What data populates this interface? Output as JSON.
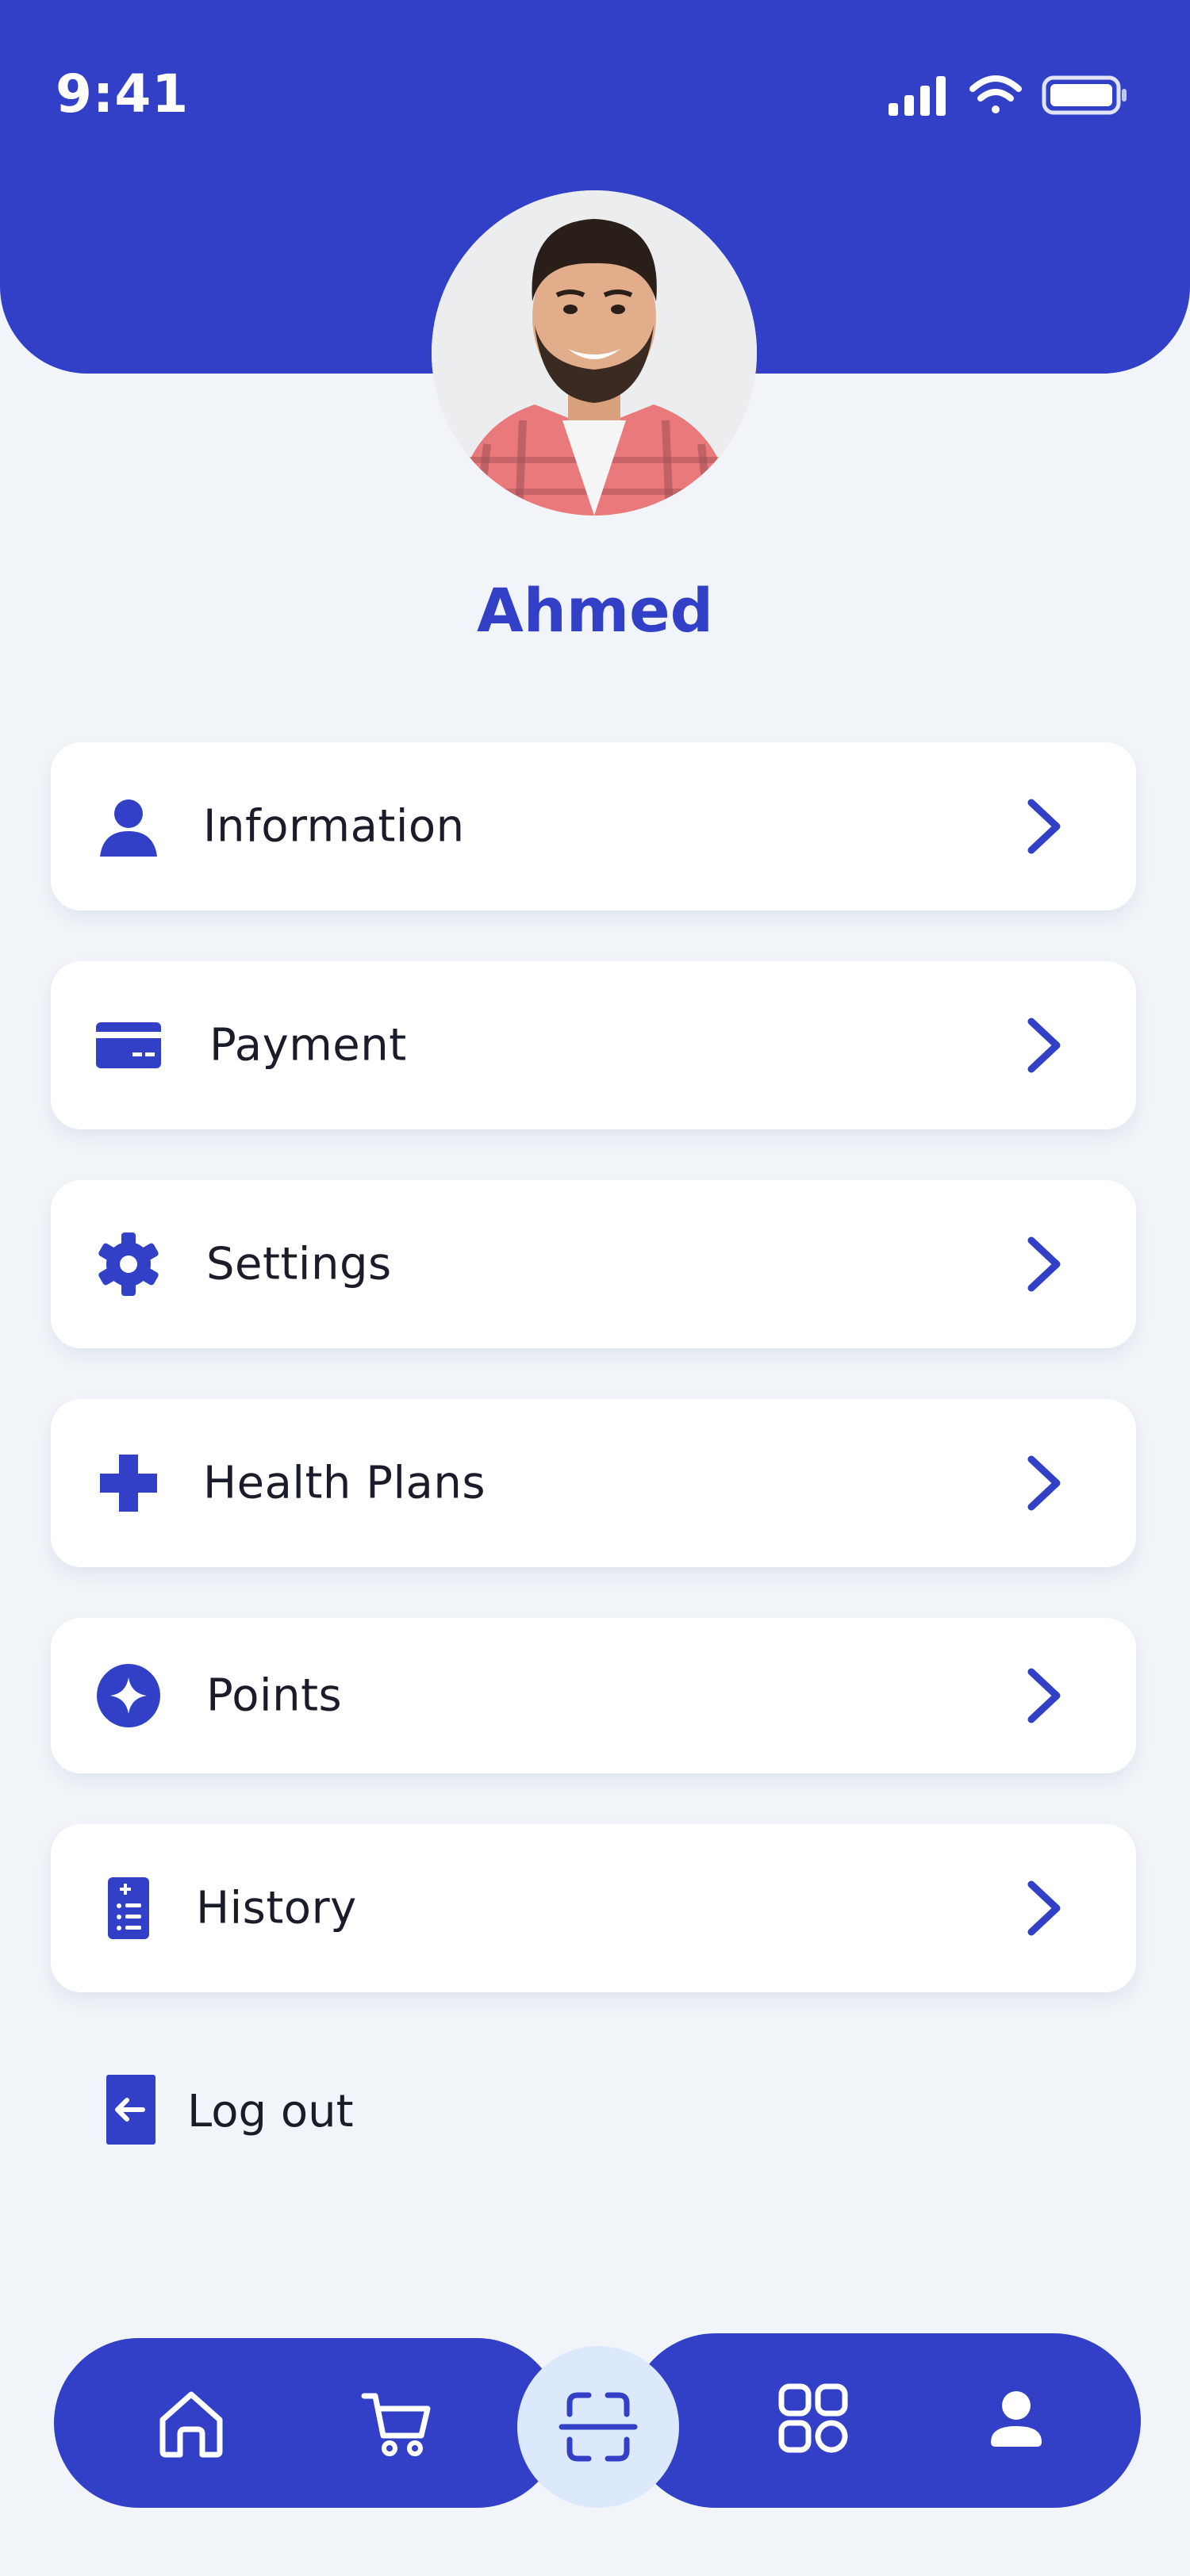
{
  "status_bar": {
    "time": "9:41",
    "icons": [
      "signal-icon",
      "wifi-icon",
      "battery-icon"
    ]
  },
  "profile": {
    "name": "Ahmed"
  },
  "menu": {
    "items": [
      {
        "label": "Information",
        "icon": "user-icon"
      },
      {
        "label": "Payment",
        "icon": "credit-card-icon"
      },
      {
        "label": "Settings",
        "icon": "gear-icon"
      },
      {
        "label": "Health Plans",
        "icon": "medical-cross-icon"
      },
      {
        "label": "Points",
        "icon": "sparkle-icon"
      },
      {
        "label": "History",
        "icon": "history-list-icon"
      }
    ],
    "logout_label": "Log out"
  },
  "bottom_nav": {
    "items": [
      "home-icon",
      "cart-icon",
      "scan-icon",
      "apps-icon",
      "profile-icon"
    ]
  },
  "colors": {
    "primary": "#3140C6",
    "background": "#F1F4F8",
    "scan_bg": "#DCE8FB",
    "text": "#1B1C2A"
  }
}
